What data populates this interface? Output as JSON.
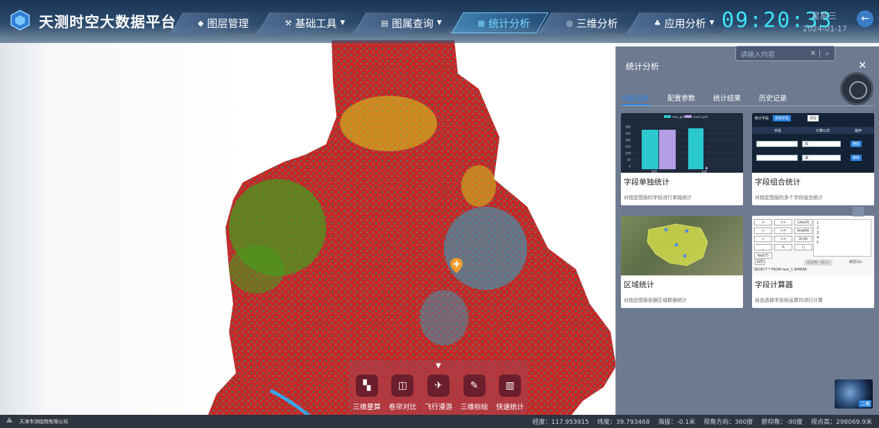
{
  "app": {
    "title": "天测时空大数据平台"
  },
  "nav": [
    {
      "label": "图层管理",
      "icon": "layers-icon",
      "glyph": "◆",
      "dropdown": false,
      "active": false
    },
    {
      "label": "基础工具",
      "icon": "tools-icon",
      "glyph": "⚒",
      "dropdown": true,
      "active": false
    },
    {
      "label": "图属查询",
      "icon": "query-icon",
      "glyph": "▤",
      "dropdown": true,
      "active": false
    },
    {
      "label": "统计分析",
      "icon": "stats-icon",
      "glyph": "▦",
      "dropdown": false,
      "active": true
    },
    {
      "label": "三维分析",
      "icon": "globe-icon",
      "glyph": "◎",
      "dropdown": false,
      "active": false
    },
    {
      "label": "应用分析",
      "icon": "apps-icon",
      "glyph": "♣",
      "dropdown": true,
      "active": false
    }
  ],
  "clock": {
    "time": "09:20:33",
    "weekday": "星期三",
    "date": "2024-01-17"
  },
  "search": {
    "placeholder": "请输入内容"
  },
  "panel": {
    "title": "统计分析",
    "tabs": [
      "功能选择",
      "配置参数",
      "统计结果",
      "历史记录"
    ],
    "active_tab": 0,
    "cards": [
      {
        "title": "字段单独统计",
        "desc": "对指定图层的字段进行单独统计"
      },
      {
        "title": "字段组合统计",
        "desc": "对指定图层的多个字段组合统计"
      },
      {
        "title": "区域统计",
        "desc": "对指定图层依据区域数据统计"
      },
      {
        "title": "字段计算器",
        "desc": "自由选择字段和运算符进行计算"
      }
    ],
    "thumb_bar": {
      "legend": [
        "max_grid",
        "count_grid"
      ],
      "y_ticks": [
        "300",
        "250",
        "200",
        "150",
        "100",
        "50",
        "0"
      ],
      "x_labels": [
        "面积",
        "长度"
      ]
    },
    "thumb_combo": {
      "header": [
        "统计字段",
        "添加字段",
        "清空"
      ],
      "cols": [
        "字段",
        "计算公式",
        "操作"
      ],
      "rows": [
        {
          "op": "加",
          "action": "删除"
        },
        {
          "op": "减",
          "action": "删除"
        }
      ]
    },
    "thumb_calc": {
      "keys": [
        "+",
        "<>",
        "Like(K)",
        ">",
        ">=",
        "And(N)",
        "<",
        "<=",
        "Or(R)",
        "_",
        "%",
        "()",
        "Not(T)"
      ],
      "values": [
        "1",
        "2",
        "3",
        "4",
        "5"
      ],
      "is_label": "Is(I)",
      "unique_btn": "获取唯一值(U)",
      "jump_label": "转至(G):",
      "sql": "SELECT * FROM test_1 WHERE"
    }
  },
  "toolbar": [
    {
      "label": "三维量算",
      "icon": "measure-icon",
      "glyph": "▚"
    },
    {
      "label": "卷帘对比",
      "icon": "swipe-icon",
      "glyph": "◫"
    },
    {
      "label": "飞行漫游",
      "icon": "plane-icon",
      "glyph": "✈"
    },
    {
      "label": "三维标绘",
      "icon": "plot-icon",
      "glyph": "✎"
    },
    {
      "label": "快速统计",
      "icon": "bar-chart-icon",
      "glyph": "▥"
    }
  ],
  "status": {
    "company": "天津市测绘院有限公司",
    "longitude": "经度：117.953915",
    "latitude": "纬度：39.793468",
    "altitude": "海拔：-0.1米",
    "heading": "视角方向：360度",
    "pitch": "俯仰角：-90度",
    "view_height": "视点高：298069.9米"
  },
  "globe_btn": "二维",
  "colors": {
    "accent": "#2a84e0",
    "clock": "#3ee3f7",
    "map_red": "#d42a2a",
    "map_green": "#4a9a1e",
    "map_yellow": "#d8d21a",
    "map_cyan": "#2aaac8"
  }
}
